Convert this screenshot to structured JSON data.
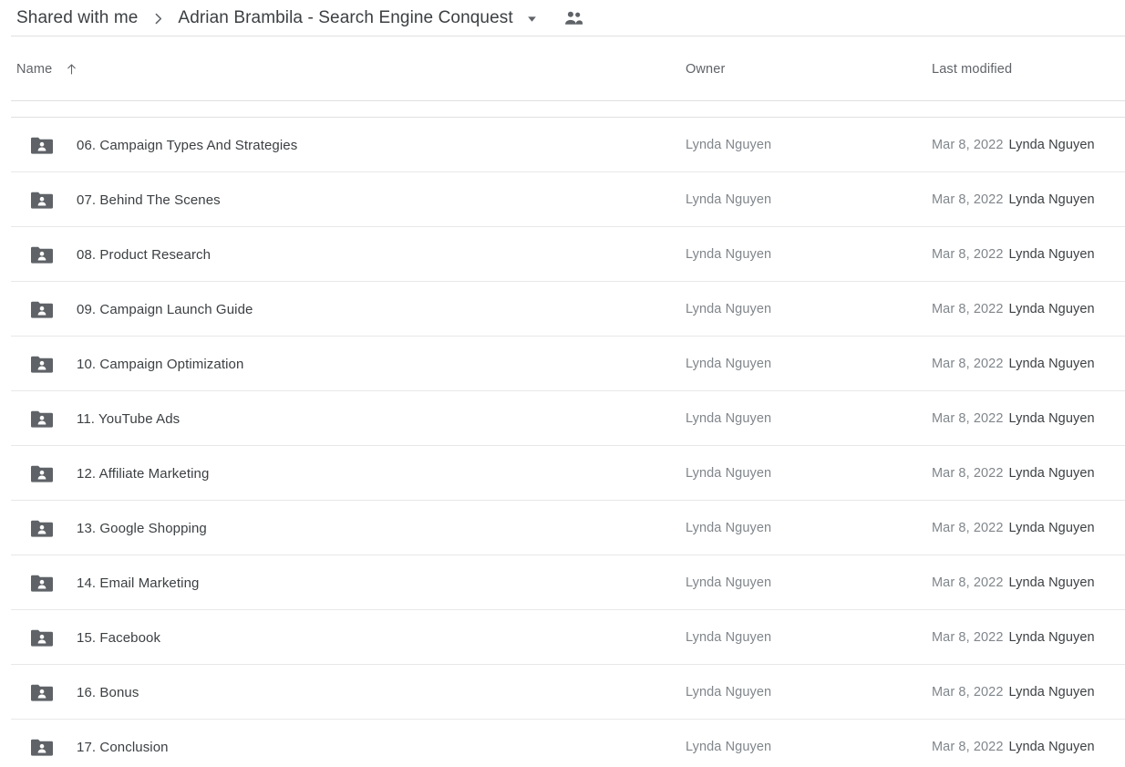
{
  "breadcrumb": {
    "root_label": "Shared with me",
    "separator_icon": "chevron-right-icon",
    "current_label": "Adrian Brambila - Search Engine Conquest",
    "caret_icon": "chevron-down-icon",
    "people_icon": "people-icon"
  },
  "columns": {
    "name_label": "Name",
    "sort_icon": "arrow-up-icon",
    "owner_label": "Owner",
    "modified_label": "Last modified"
  },
  "colors": {
    "text_primary": "#3c4043",
    "text_secondary": "#5f6368",
    "text_muted": "#80868b",
    "folder_icon": "#5f6368",
    "divider": "#e0e0e0",
    "background": "#ffffff"
  },
  "rows": [
    {
      "icon": "shared-folder-icon",
      "name": "06. Campaign Types And Strategies",
      "owner": "Lynda Nguyen",
      "modified_date": "Mar 8, 2022",
      "modified_by": "Lynda Nguyen"
    },
    {
      "icon": "shared-folder-icon",
      "name": "07. Behind The Scenes",
      "owner": "Lynda Nguyen",
      "modified_date": "Mar 8, 2022",
      "modified_by": "Lynda Nguyen"
    },
    {
      "icon": "shared-folder-icon",
      "name": "08. Product Research",
      "owner": "Lynda Nguyen",
      "modified_date": "Mar 8, 2022",
      "modified_by": "Lynda Nguyen"
    },
    {
      "icon": "shared-folder-icon",
      "name": "09. Campaign Launch Guide",
      "owner": "Lynda Nguyen",
      "modified_date": "Mar 8, 2022",
      "modified_by": "Lynda Nguyen"
    },
    {
      "icon": "shared-folder-icon",
      "name": "10. Campaign Optimization",
      "owner": "Lynda Nguyen",
      "modified_date": "Mar 8, 2022",
      "modified_by": "Lynda Nguyen"
    },
    {
      "icon": "shared-folder-icon",
      "name": "11. YouTube Ads",
      "owner": "Lynda Nguyen",
      "modified_date": "Mar 8, 2022",
      "modified_by": "Lynda Nguyen"
    },
    {
      "icon": "shared-folder-icon",
      "name": "12. Affiliate Marketing",
      "owner": "Lynda Nguyen",
      "modified_date": "Mar 8, 2022",
      "modified_by": "Lynda Nguyen"
    },
    {
      "icon": "shared-folder-icon",
      "name": "13. Google Shopping",
      "owner": "Lynda Nguyen",
      "modified_date": "Mar 8, 2022",
      "modified_by": "Lynda Nguyen"
    },
    {
      "icon": "shared-folder-icon",
      "name": "14. Email Marketing",
      "owner": "Lynda Nguyen",
      "modified_date": "Mar 8, 2022",
      "modified_by": "Lynda Nguyen"
    },
    {
      "icon": "shared-folder-icon",
      "name": "15. Facebook",
      "owner": "Lynda Nguyen",
      "modified_date": "Mar 8, 2022",
      "modified_by": "Lynda Nguyen"
    },
    {
      "icon": "shared-folder-icon",
      "name": "16. Bonus",
      "owner": "Lynda Nguyen",
      "modified_date": "Mar 8, 2022",
      "modified_by": "Lynda Nguyen"
    },
    {
      "icon": "shared-folder-icon",
      "name": "17. Conclusion",
      "owner": "Lynda Nguyen",
      "modified_date": "Mar 8, 2022",
      "modified_by": "Lynda Nguyen"
    }
  ]
}
